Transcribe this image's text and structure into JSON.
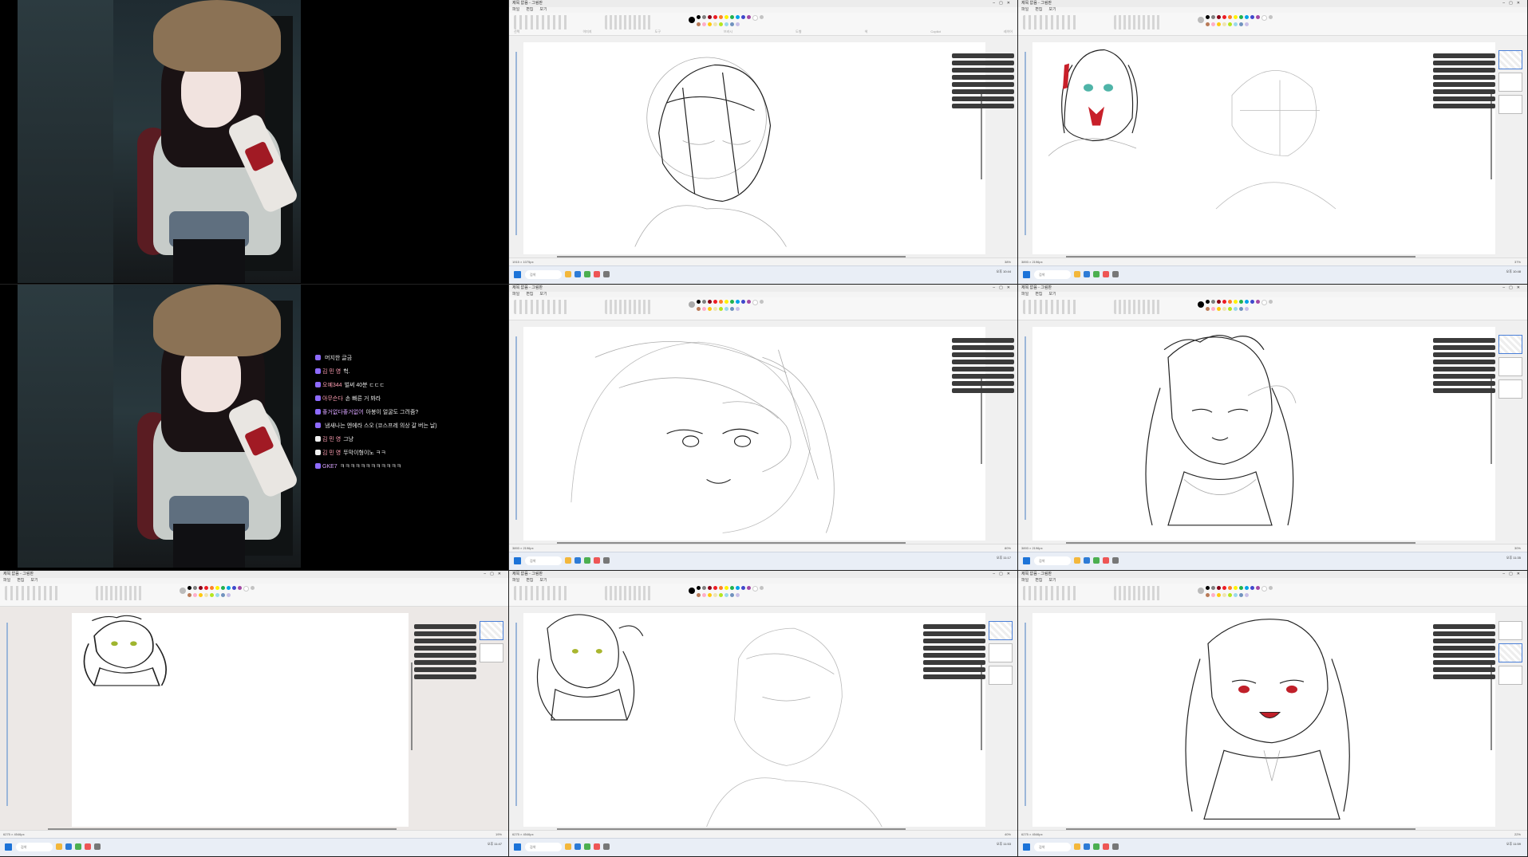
{
  "chat": {
    "messages": [
      {
        "nick": "",
        "text": "머지한 글금",
        "color": "gold"
      },
      {
        "nick": "김 민 영",
        "text": "헉.",
        "color": "pink"
      },
      {
        "nick": "오예344",
        "text": "벌써 40분 ㄷㄷㄷ",
        "color": "pink"
      },
      {
        "nick": "아무슨다",
        "text": "손 빠른 거 봐라",
        "color": "pink"
      },
      {
        "nick": "좋거없다좋거없어",
        "text": "아봉이 얼굴도 그려줌?",
        "color": "purple"
      },
      {
        "nick": "",
        "text": "냄새나는 엔에라 스오 (코스프레 의상 갈 버는 날)",
        "color": "gold"
      },
      {
        "nick": "김 민 영",
        "text": "그냥",
        "color": "pink"
      },
      {
        "nick": "김 민 영",
        "text": "뚜막이형이노 ㅋㅋ",
        "color": "pink"
      },
      {
        "nick": "GKE7",
        "text": "ㅋㅋㅋㅋㅋㅋㅋㅋㅋㅋㅋㅋ",
        "color": "purple"
      }
    ]
  },
  "paint": {
    "menu": [
      "파일",
      "편집",
      "보기"
    ],
    "ribbon_labels": [
      "선택",
      "이미지",
      "도구",
      "브러시",
      "도형",
      "색",
      "Copilot",
      "레이어"
    ],
    "search_label": "검색",
    "palette": [
      "#000000",
      "#7f7f7f",
      "#880015",
      "#ed1c24",
      "#ff7f27",
      "#fff200",
      "#22b14c",
      "#00a2e8",
      "#3f48cc",
      "#a349a4",
      "#ffffff",
      "#c3c3c3",
      "#b97a57",
      "#ffaec9",
      "#ffc90e",
      "#efe4b0",
      "#b5e61d",
      "#99d9ea",
      "#7092be",
      "#c8bfe7"
    ],
    "tiles": [
      {
        "title": "제목 없음 - 그림판",
        "status": "1915 × 1075px",
        "zoom": "38%",
        "time": "오후 10:44"
      },
      {
        "title": "제목 없음 - 그림판",
        "status": "3893 × 2196px",
        "zoom": "37%",
        "time": "오후 10:48"
      },
      {
        "title": "제목 없음 - 그림판",
        "status": "3893 × 2196px",
        "zoom": "80%",
        "time": "오후 11:17"
      },
      {
        "title": "제목 없음 - 그림판",
        "status": "3893 × 2196px",
        "zoom": "30%",
        "time": "오후 11:35"
      },
      {
        "title": "제목 없음 - 그림판",
        "status": "6275 × 4546px",
        "zoom": "19%",
        "time": "오후 11:47"
      },
      {
        "title": "제목 없음 - 그림판",
        "status": "6275 × 4546px",
        "zoom": "40%",
        "time": "오후 11:53"
      },
      {
        "title": "제목 없음 - 그림판",
        "status": "6275 × 4546px",
        "zoom": "22%",
        "time": "오후 11:59"
      }
    ]
  },
  "colors": {
    "accent": "#1c73d8",
    "chat_nick_purple": "#d9a5ff",
    "chat_nick_pink": "#ff9fb3",
    "chat_nick_gold": "#ffcf6a"
  }
}
